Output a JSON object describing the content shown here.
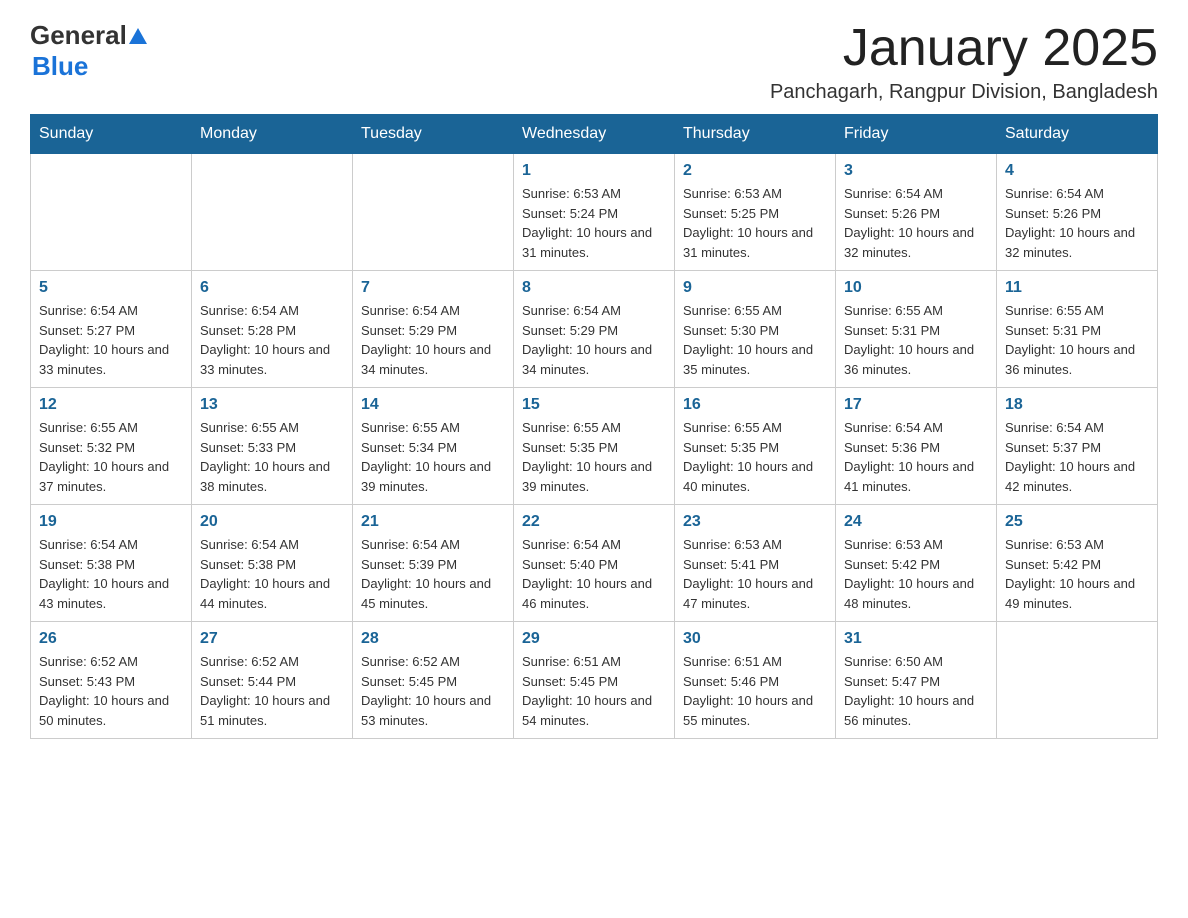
{
  "logo": {
    "general": "General",
    "blue": "Blue"
  },
  "title": "January 2025",
  "subtitle": "Panchagarh, Rangpur Division, Bangladesh",
  "days_of_week": [
    "Sunday",
    "Monday",
    "Tuesday",
    "Wednesday",
    "Thursday",
    "Friday",
    "Saturday"
  ],
  "weeks": [
    [
      {
        "day": "",
        "info": ""
      },
      {
        "day": "",
        "info": ""
      },
      {
        "day": "",
        "info": ""
      },
      {
        "day": "1",
        "info": "Sunrise: 6:53 AM\nSunset: 5:24 PM\nDaylight: 10 hours and 31 minutes."
      },
      {
        "day": "2",
        "info": "Sunrise: 6:53 AM\nSunset: 5:25 PM\nDaylight: 10 hours and 31 minutes."
      },
      {
        "day": "3",
        "info": "Sunrise: 6:54 AM\nSunset: 5:26 PM\nDaylight: 10 hours and 32 minutes."
      },
      {
        "day": "4",
        "info": "Sunrise: 6:54 AM\nSunset: 5:26 PM\nDaylight: 10 hours and 32 minutes."
      }
    ],
    [
      {
        "day": "5",
        "info": "Sunrise: 6:54 AM\nSunset: 5:27 PM\nDaylight: 10 hours and 33 minutes."
      },
      {
        "day": "6",
        "info": "Sunrise: 6:54 AM\nSunset: 5:28 PM\nDaylight: 10 hours and 33 minutes."
      },
      {
        "day": "7",
        "info": "Sunrise: 6:54 AM\nSunset: 5:29 PM\nDaylight: 10 hours and 34 minutes."
      },
      {
        "day": "8",
        "info": "Sunrise: 6:54 AM\nSunset: 5:29 PM\nDaylight: 10 hours and 34 minutes."
      },
      {
        "day": "9",
        "info": "Sunrise: 6:55 AM\nSunset: 5:30 PM\nDaylight: 10 hours and 35 minutes."
      },
      {
        "day": "10",
        "info": "Sunrise: 6:55 AM\nSunset: 5:31 PM\nDaylight: 10 hours and 36 minutes."
      },
      {
        "day": "11",
        "info": "Sunrise: 6:55 AM\nSunset: 5:31 PM\nDaylight: 10 hours and 36 minutes."
      }
    ],
    [
      {
        "day": "12",
        "info": "Sunrise: 6:55 AM\nSunset: 5:32 PM\nDaylight: 10 hours and 37 minutes."
      },
      {
        "day": "13",
        "info": "Sunrise: 6:55 AM\nSunset: 5:33 PM\nDaylight: 10 hours and 38 minutes."
      },
      {
        "day": "14",
        "info": "Sunrise: 6:55 AM\nSunset: 5:34 PM\nDaylight: 10 hours and 39 minutes."
      },
      {
        "day": "15",
        "info": "Sunrise: 6:55 AM\nSunset: 5:35 PM\nDaylight: 10 hours and 39 minutes."
      },
      {
        "day": "16",
        "info": "Sunrise: 6:55 AM\nSunset: 5:35 PM\nDaylight: 10 hours and 40 minutes."
      },
      {
        "day": "17",
        "info": "Sunrise: 6:54 AM\nSunset: 5:36 PM\nDaylight: 10 hours and 41 minutes."
      },
      {
        "day": "18",
        "info": "Sunrise: 6:54 AM\nSunset: 5:37 PM\nDaylight: 10 hours and 42 minutes."
      }
    ],
    [
      {
        "day": "19",
        "info": "Sunrise: 6:54 AM\nSunset: 5:38 PM\nDaylight: 10 hours and 43 minutes."
      },
      {
        "day": "20",
        "info": "Sunrise: 6:54 AM\nSunset: 5:38 PM\nDaylight: 10 hours and 44 minutes."
      },
      {
        "day": "21",
        "info": "Sunrise: 6:54 AM\nSunset: 5:39 PM\nDaylight: 10 hours and 45 minutes."
      },
      {
        "day": "22",
        "info": "Sunrise: 6:54 AM\nSunset: 5:40 PM\nDaylight: 10 hours and 46 minutes."
      },
      {
        "day": "23",
        "info": "Sunrise: 6:53 AM\nSunset: 5:41 PM\nDaylight: 10 hours and 47 minutes."
      },
      {
        "day": "24",
        "info": "Sunrise: 6:53 AM\nSunset: 5:42 PM\nDaylight: 10 hours and 48 minutes."
      },
      {
        "day": "25",
        "info": "Sunrise: 6:53 AM\nSunset: 5:42 PM\nDaylight: 10 hours and 49 minutes."
      }
    ],
    [
      {
        "day": "26",
        "info": "Sunrise: 6:52 AM\nSunset: 5:43 PM\nDaylight: 10 hours and 50 minutes."
      },
      {
        "day": "27",
        "info": "Sunrise: 6:52 AM\nSunset: 5:44 PM\nDaylight: 10 hours and 51 minutes."
      },
      {
        "day": "28",
        "info": "Sunrise: 6:52 AM\nSunset: 5:45 PM\nDaylight: 10 hours and 53 minutes."
      },
      {
        "day": "29",
        "info": "Sunrise: 6:51 AM\nSunset: 5:45 PM\nDaylight: 10 hours and 54 minutes."
      },
      {
        "day": "30",
        "info": "Sunrise: 6:51 AM\nSunset: 5:46 PM\nDaylight: 10 hours and 55 minutes."
      },
      {
        "day": "31",
        "info": "Sunrise: 6:50 AM\nSunset: 5:47 PM\nDaylight: 10 hours and 56 minutes."
      },
      {
        "day": "",
        "info": ""
      }
    ]
  ]
}
